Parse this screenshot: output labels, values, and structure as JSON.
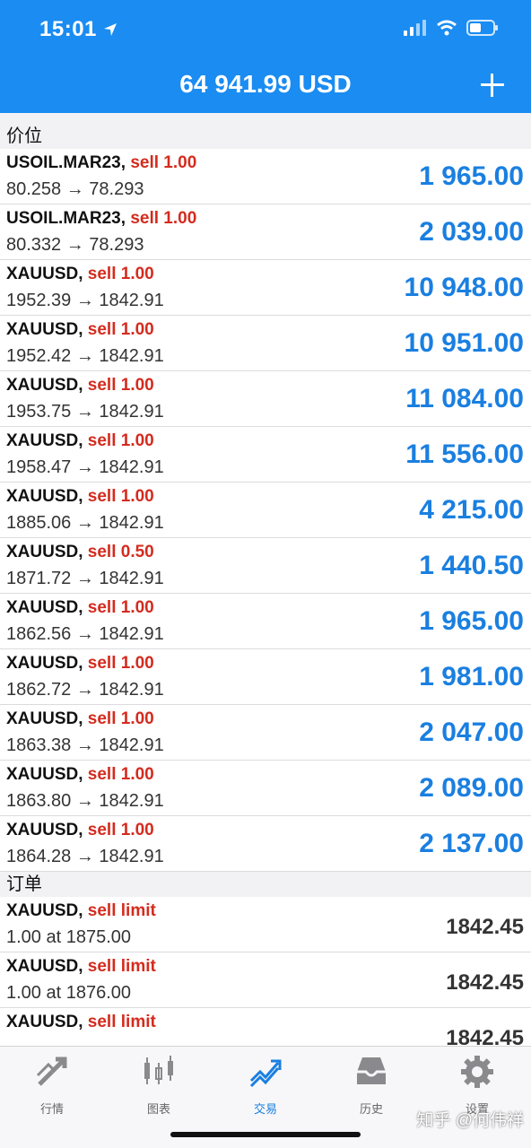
{
  "status": {
    "time": "15:01"
  },
  "nav": {
    "title": "64 941.99 USD"
  },
  "sections": {
    "positions_label": "价位",
    "orders_label": "订单"
  },
  "positions": [
    {
      "symbol": "USOIL.MAR23",
      "type": "sell 1.00",
      "prices": "80.258 → 78.293",
      "profit": "1 965.00"
    },
    {
      "symbol": "USOIL.MAR23",
      "type": "sell 1.00",
      "prices": "80.332 → 78.293",
      "profit": "2 039.00"
    },
    {
      "symbol": "XAUUSD",
      "type": "sell 1.00",
      "prices": "1952.39 → 1842.91",
      "profit": "10 948.00"
    },
    {
      "symbol": "XAUUSD",
      "type": "sell 1.00",
      "prices": "1952.42 → 1842.91",
      "profit": "10 951.00"
    },
    {
      "symbol": "XAUUSD",
      "type": "sell 1.00",
      "prices": "1953.75 → 1842.91",
      "profit": "11 084.00"
    },
    {
      "symbol": "XAUUSD",
      "type": "sell 1.00",
      "prices": "1958.47 → 1842.91",
      "profit": "11 556.00"
    },
    {
      "symbol": "XAUUSD",
      "type": "sell 1.00",
      "prices": "1885.06 → 1842.91",
      "profit": "4 215.00"
    },
    {
      "symbol": "XAUUSD",
      "type": "sell 0.50",
      "prices": "1871.72 → 1842.91",
      "profit": "1 440.50"
    },
    {
      "symbol": "XAUUSD",
      "type": "sell 1.00",
      "prices": "1862.56 → 1842.91",
      "profit": "1 965.00"
    },
    {
      "symbol": "XAUUSD",
      "type": "sell 1.00",
      "prices": "1862.72 → 1842.91",
      "profit": "1 981.00"
    },
    {
      "symbol": "XAUUSD",
      "type": "sell 1.00",
      "prices": "1863.38 → 1842.91",
      "profit": "2 047.00"
    },
    {
      "symbol": "XAUUSD",
      "type": "sell 1.00",
      "prices": "1863.80 → 1842.91",
      "profit": "2 089.00"
    },
    {
      "symbol": "XAUUSD",
      "type": "sell 1.00",
      "prices": "1864.28 → 1842.91",
      "profit": "2 137.00"
    }
  ],
  "orders": [
    {
      "symbol": "XAUUSD",
      "type": "sell limit",
      "detail": "1.00 at 1875.00",
      "price": "1842.45"
    },
    {
      "symbol": "XAUUSD",
      "type": "sell limit",
      "detail": "1.00 at 1876.00",
      "price": "1842.45"
    },
    {
      "symbol": "XAUUSD",
      "type": "sell limit",
      "detail": "",
      "price": "1842.45"
    }
  ],
  "tabs": [
    {
      "label": "行情",
      "icon": "quotes-icon"
    },
    {
      "label": "图表",
      "icon": "chart-icon"
    },
    {
      "label": "交易",
      "icon": "trade-icon",
      "active": true
    },
    {
      "label": "历史",
      "icon": "history-icon"
    },
    {
      "label": "设置",
      "icon": "settings-icon"
    }
  ],
  "watermark": "知乎 @何伟祥",
  "colors": {
    "accent": "#1a8cf2",
    "profit": "#1a7fe0",
    "sell": "#d42b1e"
  }
}
